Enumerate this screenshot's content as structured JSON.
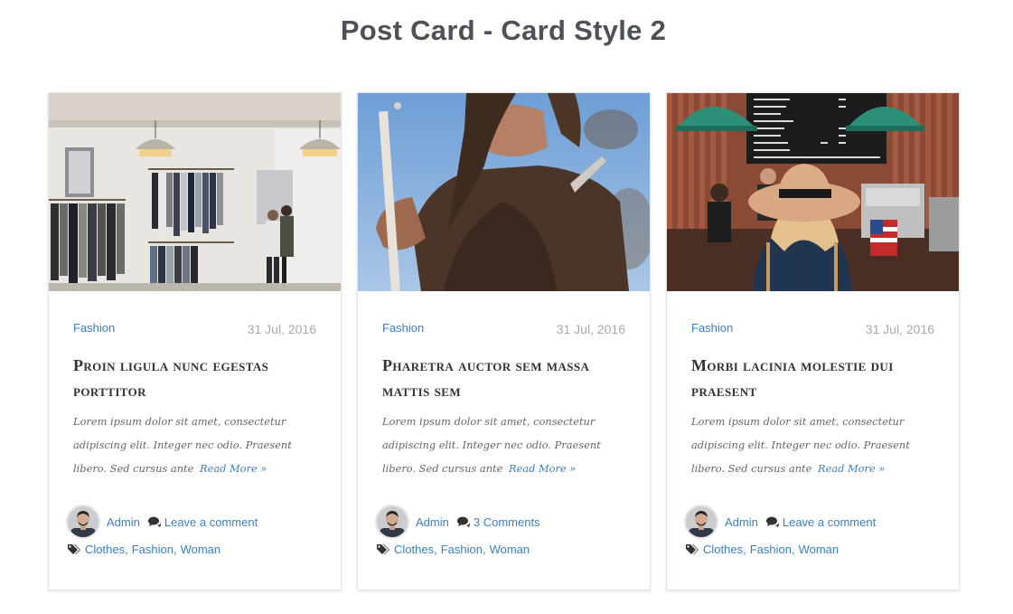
{
  "page": {
    "title": "Post Card - Card Style 2"
  },
  "cards": [
    {
      "image_icon": "clothing-store-photo",
      "category": "Fashion",
      "date": "31 Jul, 2016",
      "title": "Proin ligula nunc egestas porttitor",
      "excerpt": "Lorem ipsum dolor sit amet, consectetur adipiscing elit. Integer nec odio. Praesent libero. Sed cursus ante",
      "read_more": "Read More »",
      "author": "Admin",
      "comments": "Leave a comment",
      "tags": [
        "Clothes",
        "Fashion",
        "Woman"
      ]
    },
    {
      "image_icon": "woman-outdoors-photo",
      "category": "Fashion",
      "date": "31 Jul, 2016",
      "title": "Pharetra auctor sem massa mattis sem",
      "excerpt": "Lorem ipsum dolor sit amet, consectetur adipiscing elit. Integer nec odio. Praesent libero. Sed cursus ante",
      "read_more": "Read More »",
      "author": "Admin",
      "comments": "3 Comments",
      "tags": [
        "Clothes",
        "Fashion",
        "Woman"
      ]
    },
    {
      "image_icon": "coffee-shop-photo",
      "category": "Fashion",
      "date": "31 Jul, 2016",
      "title": "Morbi lacinia molestie dui praesent",
      "excerpt": "Lorem ipsum dolor sit amet, consectetur adipiscing elit. Integer nec odio. Praesent libero. Sed cursus ante",
      "read_more": "Read More »",
      "author": "Admin",
      "comments": "Leave a comment",
      "tags": [
        "Clothes",
        "Fashion",
        "Woman"
      ]
    }
  ],
  "colors": {
    "link": "#3a7fc2",
    "title": "#4d5258",
    "date": "#a8a8a8"
  }
}
